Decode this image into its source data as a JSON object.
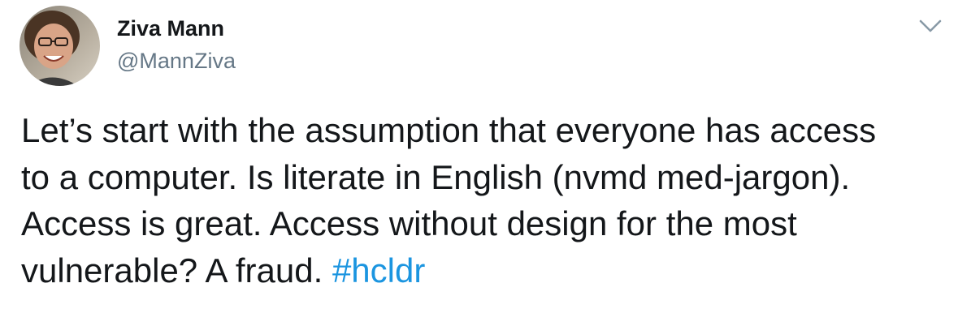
{
  "author": {
    "name": "Ziva Mann",
    "handle": "@MannZiva"
  },
  "menu": {
    "icon": "chevron-down-icon"
  },
  "tweet": {
    "lines": [
      "Let’s start with the assumption that everyone has access",
      "to a computer. Is literate in English (nvmd med-jargon).",
      "Access is great. Access without design for the most",
      "vulnerable? A fraud. "
    ],
    "hashtag": "#hcldr"
  },
  "colors": {
    "text": "#14171a",
    "secondary": "#657786",
    "link": "#1b95e0"
  }
}
